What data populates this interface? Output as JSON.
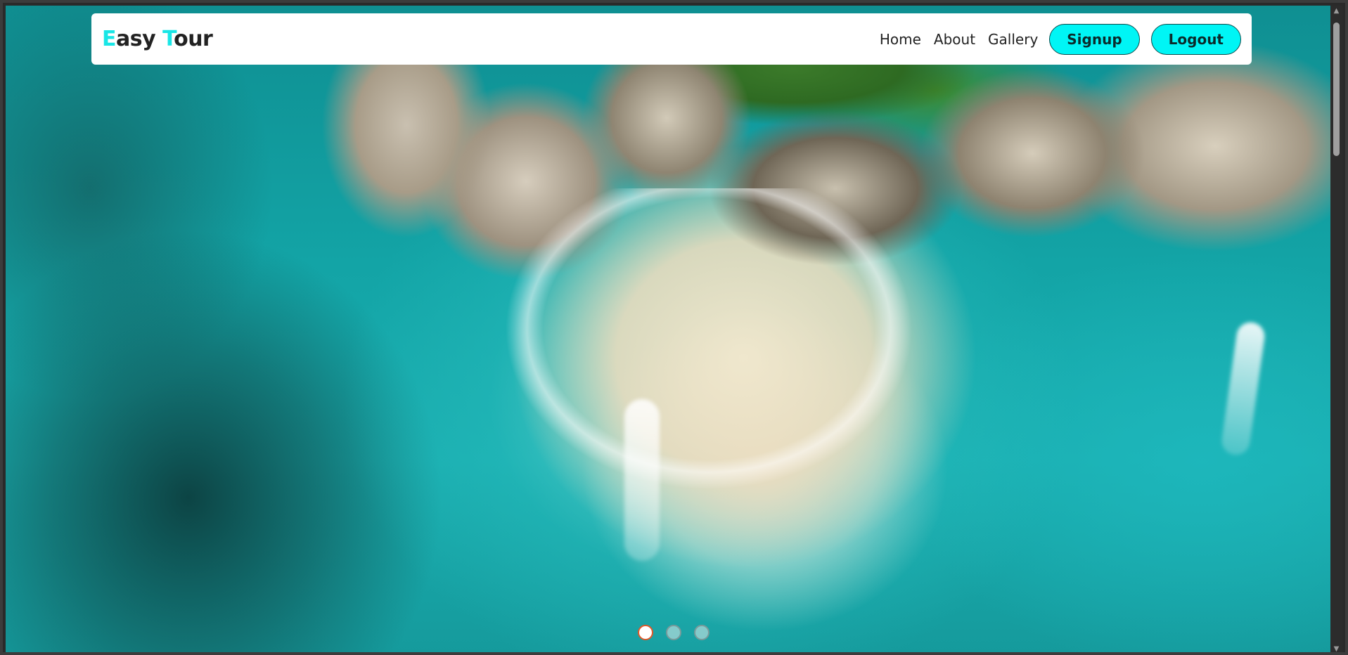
{
  "navbar": {
    "logo": {
      "first_letter": "E",
      "first_rest": "asy ",
      "second_letter": "T",
      "second_rest": "our"
    },
    "links": [
      "Home",
      "About",
      "Gallery"
    ],
    "buttons": {
      "signup": "Signup",
      "logout": "Logout"
    }
  },
  "carousel": {
    "slide_count": 3,
    "active_index": 0
  },
  "colors": {
    "accent": "#00f5f5",
    "logo_accent": "#19e6e6",
    "active_dot_border": "#e0592a"
  },
  "scrollbar": {
    "up_icon": "▲",
    "down_icon": "▼"
  }
}
